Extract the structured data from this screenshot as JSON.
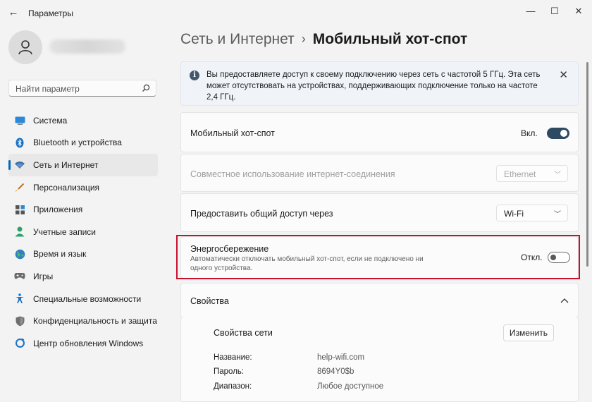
{
  "window": {
    "title": "Параметры",
    "controls": [
      "minimize",
      "maximize",
      "close"
    ]
  },
  "search": {
    "placeholder": "Найти параметр"
  },
  "sidebar": {
    "items": [
      {
        "label": "Система",
        "icon": "monitor-icon",
        "active": false
      },
      {
        "label": "Bluetooth и устройства",
        "icon": "bluetooth-icon",
        "active": false
      },
      {
        "label": "Сеть и Интернет",
        "icon": "wifi-icon",
        "active": true
      },
      {
        "label": "Персонализация",
        "icon": "brush-icon",
        "active": false
      },
      {
        "label": "Приложения",
        "icon": "apps-icon",
        "active": false
      },
      {
        "label": "Учетные записи",
        "icon": "person-icon",
        "active": false
      },
      {
        "label": "Время и язык",
        "icon": "globe-icon",
        "active": false
      },
      {
        "label": "Игры",
        "icon": "gamepad-icon",
        "active": false
      },
      {
        "label": "Специальные возможности",
        "icon": "accessibility-icon",
        "active": false
      },
      {
        "label": "Конфиденциальность и защита",
        "icon": "shield-icon",
        "active": false
      },
      {
        "label": "Центр обновления Windows",
        "icon": "update-icon",
        "active": false
      }
    ]
  },
  "breadcrumb": {
    "parent": "Сеть и Интернет",
    "separator": "›",
    "current": "Мобильный хот-спот"
  },
  "info_bar": {
    "text": "Вы предоставляете доступ к своему подключению через сеть с частотой 5 ГГц. Эта сеть может отсутствовать на устройствах, поддерживающих подключение только на частоте 2,4 ГГц."
  },
  "settings": {
    "hotspot": {
      "label": "Мобильный хот-спот",
      "state": "Вкл.",
      "on": true
    },
    "share_connection": {
      "label": "Совместное использование интернет-соединения",
      "value": "Ethernet",
      "disabled": true
    },
    "share_over": {
      "label": "Предоставить общий доступ через",
      "value": "Wi-Fi"
    },
    "power_saving": {
      "label": "Энергосбережение",
      "description": "Автоматически отключать мобильный хот-спот, если не подключено ни одного устройства.",
      "state": "Откл.",
      "on": false
    }
  },
  "properties": {
    "header": "Свойства",
    "section_title": "Свойства сети",
    "edit_button": "Изменить",
    "fields": [
      {
        "key": "Название:",
        "value": "help-wifi.com"
      },
      {
        "key": "Пароль:",
        "value": "8694Y0$b"
      },
      {
        "key": "Диапазон:",
        "value": "Любое доступное"
      }
    ]
  },
  "colors": {
    "accent": "#0067c0",
    "toggle_on": "#2e4a62",
    "highlight_border": "#c8102e",
    "background": "#f3f3f3"
  }
}
